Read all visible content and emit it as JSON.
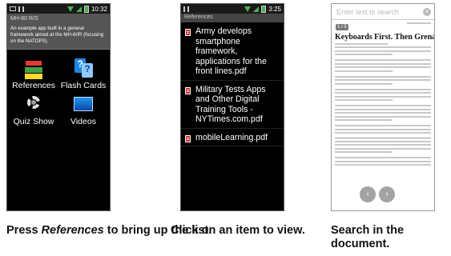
{
  "screen1": {
    "status_time": "10:32",
    "app_title": "MH-60 R/S",
    "description": "An example app built in a general framework aimed at the MH-60R (focusing on the NATOPS)",
    "items": [
      {
        "label": "References",
        "icon": "books-icon"
      },
      {
        "label": "Flash Cards",
        "icon": "flash-cards-icon"
      },
      {
        "label": "Quiz Show",
        "icon": "quiz-show-icon"
      },
      {
        "label": "Videos",
        "icon": "video-icon"
      }
    ]
  },
  "screen2": {
    "status_time": "3:25",
    "title": "References",
    "items": [
      "Army develops smartphone framework, applications for the front lines.pdf",
      "Military Tests Apps and Other Digital Training Tools - NYTimes.com.pdf",
      "mobileLearning.pdf"
    ]
  },
  "screen3": {
    "search_placeholder": "Enter text to search",
    "page_indicator": "1 / 5",
    "doc_title": "Keyboards First. Then Grenades.",
    "clear_glyph": "×",
    "prev_glyph": "‹",
    "next_glyph": "›"
  },
  "captions": {
    "c1_prefix": "Press ",
    "c1_em": "References",
    "c1_suffix": " to bring up the list.",
    "c2": "Click on an item to view.",
    "c3": "Search in the document."
  },
  "colors": {
    "accent_green": "#4caf50",
    "titlebar": "#555555"
  }
}
